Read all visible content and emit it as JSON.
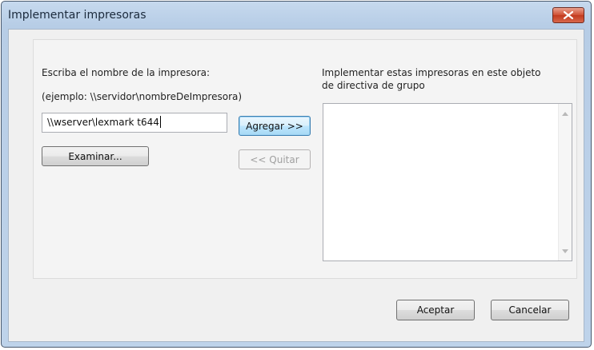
{
  "window": {
    "title": "Implementar impresoras"
  },
  "left_panel": {
    "prompt_label": "Escriba el nombre de la impresora:",
    "example_label": "(ejemplo: \\\\servidor\\nombreDeImpresora)",
    "printer_input_value": "\\\\wserver\\lexmark t644",
    "browse_button": "Examinar..."
  },
  "middle": {
    "add_button": "Agregar >>",
    "remove_button": "<< Quitar"
  },
  "right_panel": {
    "list_label_line1": "Implementar estas impresoras en este objeto",
    "list_label_line2": "de directiva de grupo",
    "items": []
  },
  "footer": {
    "ok_button": "Aceptar",
    "cancel_button": "Cancelar"
  },
  "colors": {
    "close_button": "#c23a1f",
    "focus_border": "#3c7fb1"
  }
}
